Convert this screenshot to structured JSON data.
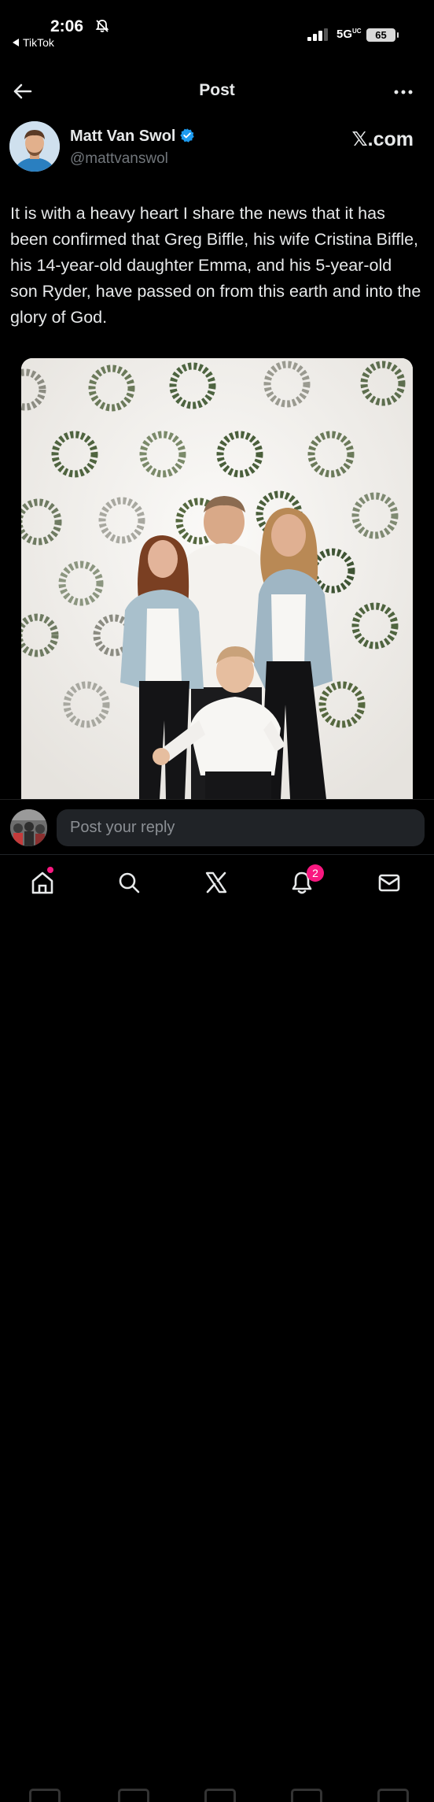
{
  "status_bar": {
    "time": "2:06",
    "back_app": "TikTok",
    "network": "5G",
    "network_suffix": "UC",
    "battery": "65"
  },
  "header": {
    "title": "Post"
  },
  "author": {
    "name": "Matt Van Swol",
    "handle": "@mattvanswol",
    "source": "𝕏.com"
  },
  "post": {
    "text": "It is with a heavy heart I share the news that it has been confirmed that Greg Biffle, his wife Cristina Biffle, his 14-year-old daughter Emma, and his 5-year-old son Ryder, have passed on from this earth and into the glory of God."
  },
  "reply": {
    "placeholder": "Post your reply"
  },
  "bottom_nav": {
    "notifications_count": "2",
    "items": [
      "home-icon",
      "search-icon",
      "x-grok-icon",
      "bell-icon",
      "mail-icon"
    ]
  },
  "colors": {
    "background": "#000000",
    "text": "#e7e9ea",
    "secondary_text": "#71767b",
    "verified": "#1d9bf0",
    "badge": "#f91880"
  }
}
